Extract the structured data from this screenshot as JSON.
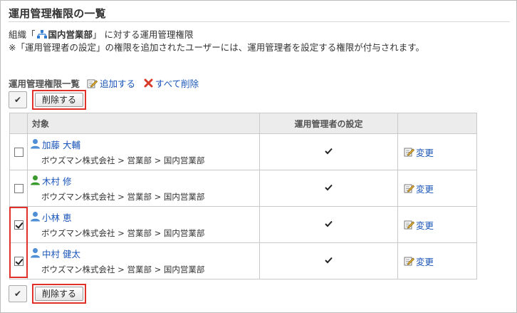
{
  "page": {
    "title": "運用管理権限の一覧",
    "org_prefix": "組織「",
    "org_name": "国内営業部",
    "org_suffix": "」 に対する運用管理権限",
    "note": "※「運用管理者の設定」の権限を追加されたユーザーには、運用管理者を設定する権限が付与されます。"
  },
  "section": {
    "title": "運用管理権限一覧",
    "add_label": "追加する",
    "delete_all_label": "すべて削除"
  },
  "toolbar": {
    "delete_label": "削除する",
    "select_all_mark": "✔"
  },
  "table": {
    "headers": {
      "target": "対象",
      "setting": "運用管理者の設定"
    },
    "change_label": "変更",
    "rows": [
      {
        "name": "加藤 大輔",
        "path": "ボウズマン株式会社 > 営業部 > 国内営業部",
        "checked": false,
        "icon_color": "#4f8fd6"
      },
      {
        "name": "木村 修",
        "path": "ボウズマン株式会社 > 営業部 > 国内営業部",
        "checked": false,
        "icon_color": "#3a9a2e"
      },
      {
        "name": "小林 恵",
        "path": "ボウズマン株式会社 > 営業部 > 国内営業部",
        "checked": true,
        "icon_color": "#4f8fd6"
      },
      {
        "name": "中村 健太",
        "path": "ボウズマン株式会社 > 営業部 > 国内営業部",
        "checked": true,
        "icon_color": "#4f8fd6"
      }
    ]
  },
  "colors": {
    "link": "#1a55b8",
    "highlight": "#e0302a",
    "header_bg": "#ececec"
  }
}
